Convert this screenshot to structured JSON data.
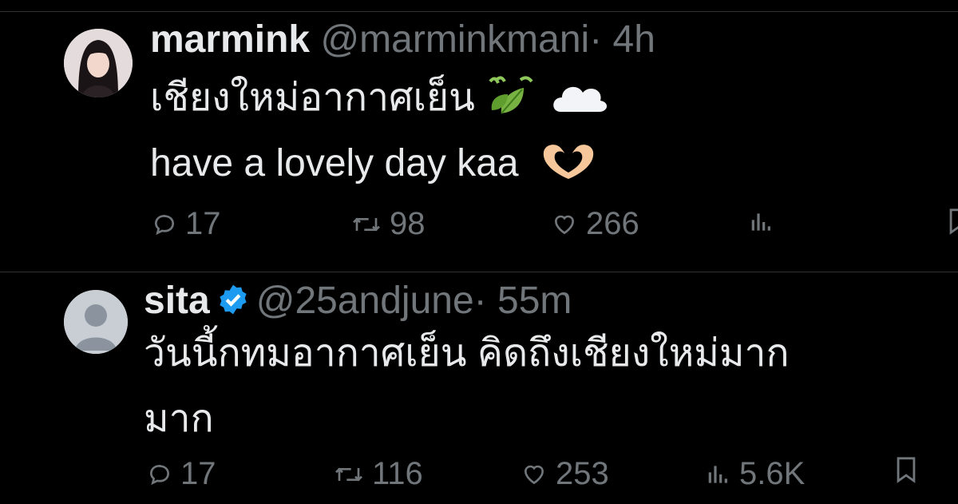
{
  "tweets": [
    {
      "name": "marmink",
      "handle": "@marminkmani",
      "separator": "·",
      "time": "4h",
      "text_lines": [
        "เชียงใหม่อากาศเย็น",
        "have a lovely day kaa"
      ],
      "emojis": [
        "leaf-fluttering-in-wind-emoji",
        "cloud-emoji",
        "heart-hands-emoji"
      ],
      "stats": {
        "replies": "17",
        "retweets": "98",
        "likes": "266"
      },
      "verified": false
    },
    {
      "name": "sita",
      "handle": "@25andjune",
      "separator": "·",
      "time": "55m",
      "text_lines": [
        "วันนี้กทมอากาศเย็น คิดถึงเชียงใหม่มาก",
        "มาก"
      ],
      "stats": {
        "replies": "17",
        "retweets": "116",
        "likes": "253",
        "views": "5.6K"
      },
      "verified": true
    }
  ],
  "colors": {
    "background": "#000000",
    "text": "#e7e9ea",
    "muted": "#71767b",
    "divider": "#2f3336",
    "verified_badge": "#1d9bf0"
  },
  "icons": [
    "reply-icon",
    "retweet-icon",
    "like-icon",
    "views-icon",
    "bookmark-icon",
    "verified-badge-icon"
  ]
}
